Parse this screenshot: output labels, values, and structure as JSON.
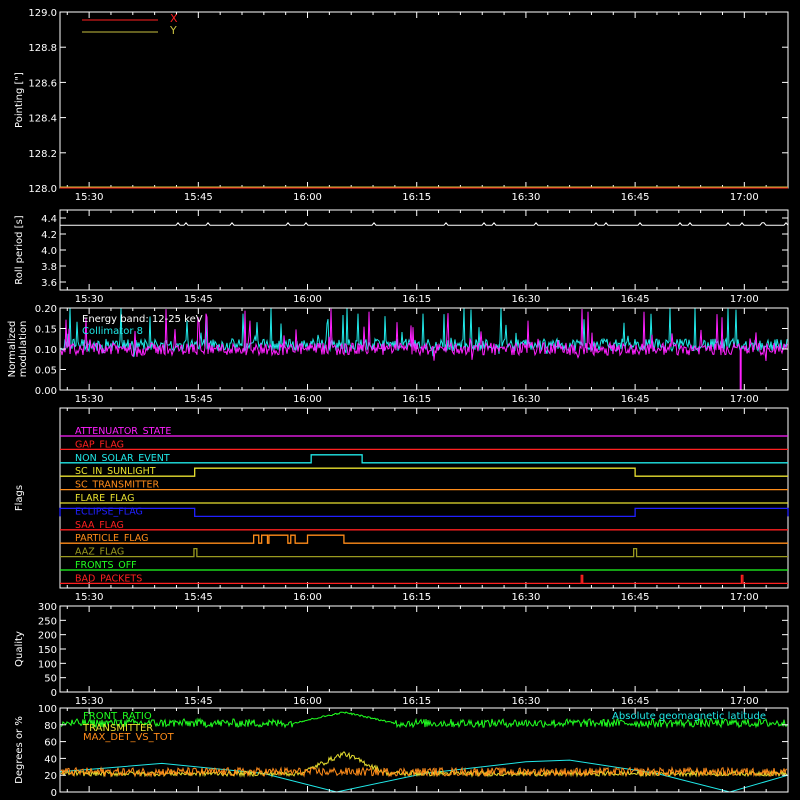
{
  "time_ticks": [
    "15:30",
    "15:45",
    "16:00",
    "16:15",
    "16:30",
    "16:45",
    "17:00"
  ],
  "time_tick_minutes": [
    0,
    15,
    30,
    45,
    60,
    75,
    90
  ],
  "time_range_minutes": [
    -4,
    96
  ],
  "colors": {
    "background": "#000000",
    "axes": "#ffffff",
    "red": "#ff2020",
    "yellow": "#e8e030",
    "cyan": "#20e8e8",
    "magenta": "#ff20ff",
    "green": "#20ff20",
    "orange": "#ff8c1a",
    "blue": "#2020ff",
    "olive": "#9a9a20"
  },
  "chart_data": [
    {
      "type": "line",
      "panel": "pointing",
      "ylabel": "Pointing [\"]",
      "ylim": [
        128.0,
        129.0
      ],
      "yticks": [
        "128.0",
        "128.2",
        "128.4",
        "128.6",
        "128.8",
        "129.0"
      ],
      "series": [
        {
          "name": "X",
          "color": "#ff2020",
          "value": 128.0
        },
        {
          "name": "Y",
          "color": "#c8c040",
          "value": 128.0
        }
      ]
    },
    {
      "type": "line",
      "panel": "roll",
      "ylabel": "Roll period [s]",
      "ylim": [
        3.5,
        4.5
      ],
      "yticks": [
        "3.6",
        "3.8",
        "4.0",
        "4.2",
        "4.4"
      ],
      "series": [
        {
          "color": "#ffffff",
          "baseline": 4.31,
          "bump": 4.34
        }
      ]
    },
    {
      "type": "line",
      "panel": "modulation",
      "ylabel": "Normalized modulation",
      "ylim": [
        0.0,
        0.2
      ],
      "yticks": [
        "0.00",
        "0.05",
        "0.10",
        "0.15",
        "0.20"
      ],
      "annotations": [
        "Energy band: 12-25 keV",
        "Collimator 8"
      ],
      "series": [
        {
          "color": "#20e8e8",
          "mean": 0.11
        },
        {
          "color": "#ff20ff",
          "mean": 0.1
        }
      ]
    },
    {
      "type": "line",
      "panel": "flags",
      "ylabel": "Flags",
      "flags": [
        {
          "label": "ATTENUATOR_STATE",
          "color": "#ff20ff",
          "on": []
        },
        {
          "label": "GAP_FLAG",
          "color": "#ff2020",
          "on": []
        },
        {
          "label": "NON_SOLAR_EVENT",
          "color": "#20e8e8",
          "on": [
            [
              30.5,
              37.5
            ]
          ]
        },
        {
          "label": "SC_IN_SUNLIGHT",
          "color": "#e8e030",
          "on": [
            [
              14.5,
              75.0
            ]
          ]
        },
        {
          "label": "SC_TRANSMITTER",
          "color": "#ff8c1a",
          "on": []
        },
        {
          "label": "FLARE_FLAG",
          "color": "#e8e030",
          "on": []
        },
        {
          "label": "ECLIPSE_FLAG",
          "color": "#2020ff",
          "on": [
            [
              -4,
              14.5
            ],
            [
              75.0,
              96
            ]
          ]
        },
        {
          "label": "SAA_FLAG",
          "color": "#ff2020",
          "on": []
        },
        {
          "label": "PARTICLE_FLAG",
          "color": "#ff8c1a",
          "on": [
            [
              22.6,
              23.3
            ],
            [
              23.7,
              24.5
            ],
            [
              24.7,
              27.3
            ],
            [
              27.7,
              28.3
            ],
            [
              30.0,
              35.0
            ]
          ]
        },
        {
          "label": "AAZ_FLAG",
          "color": "#9a9a20",
          "on": [
            [
              14.4,
              14.8
            ],
            [
              74.8,
              75.2
            ]
          ]
        },
        {
          "label": "FRONTS_OFF",
          "color": "#20ff20",
          "on": []
        },
        {
          "label": "BAD_PACKETS",
          "color": "#ff2020",
          "on": [
            [
              67.6,
              67.8
            ],
            [
              89.6,
              89.8
            ]
          ]
        }
      ]
    },
    {
      "type": "line",
      "panel": "quality",
      "ylabel": "Quality",
      "ylim": [
        0,
        300
      ],
      "yticks": [
        "0",
        "50",
        "100",
        "150",
        "200",
        "250",
        "300"
      ],
      "series": []
    },
    {
      "type": "line",
      "panel": "latitude",
      "ylabel": "Degrees or %",
      "ylim": [
        0,
        100
      ],
      "yticks": [
        "0",
        "20",
        "40",
        "60",
        "80",
        "100"
      ],
      "series": [
        {
          "name": "FRONT_RATIO",
          "color": "#20ff20",
          "mean": 82
        },
        {
          "name": "TRANSMITTER",
          "color": "#e8e030",
          "mean": 22
        },
        {
          "name": "MAX_DET_VS_TOT",
          "color": "#ff8c1a",
          "mean": 24
        },
        {
          "name": "Absolute geomagnetic latitude",
          "color": "#20e8e8"
        }
      ]
    }
  ]
}
